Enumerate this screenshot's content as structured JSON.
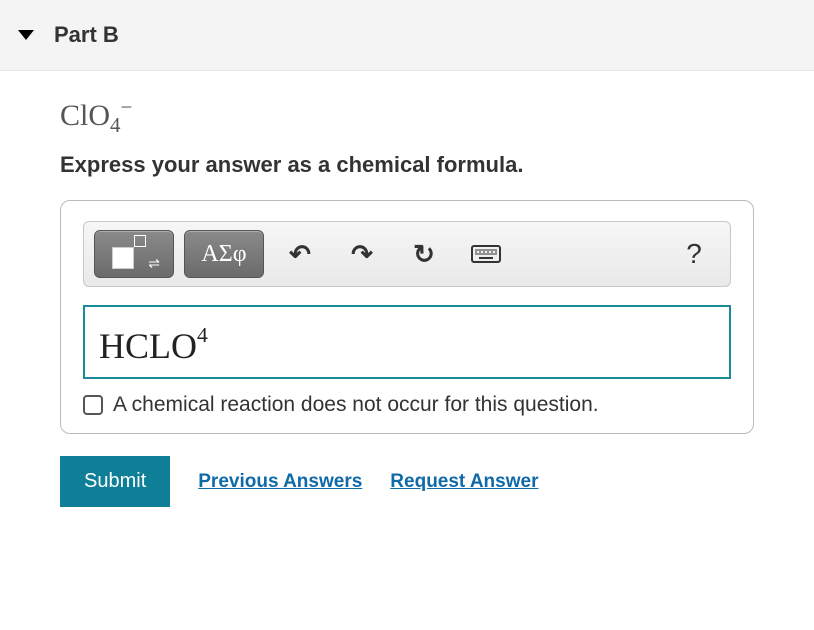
{
  "header": {
    "title": "Part B"
  },
  "question": {
    "formula_base": "ClO",
    "formula_sub": "4",
    "formula_sup": "−",
    "instruction": "Express your answer as a chemical formula."
  },
  "toolbar": {
    "greek_label": "ΑΣφ",
    "undo_icon": "↶",
    "redo_icon": "↷",
    "reset_icon": "↻",
    "help_icon": "?"
  },
  "answer": {
    "value_base": "HCLO",
    "value_sup": "4"
  },
  "checkbox": {
    "label": "A chemical reaction does not occur for this question."
  },
  "actions": {
    "submit": "Submit",
    "previous": "Previous Answers",
    "request": "Request Answer"
  }
}
